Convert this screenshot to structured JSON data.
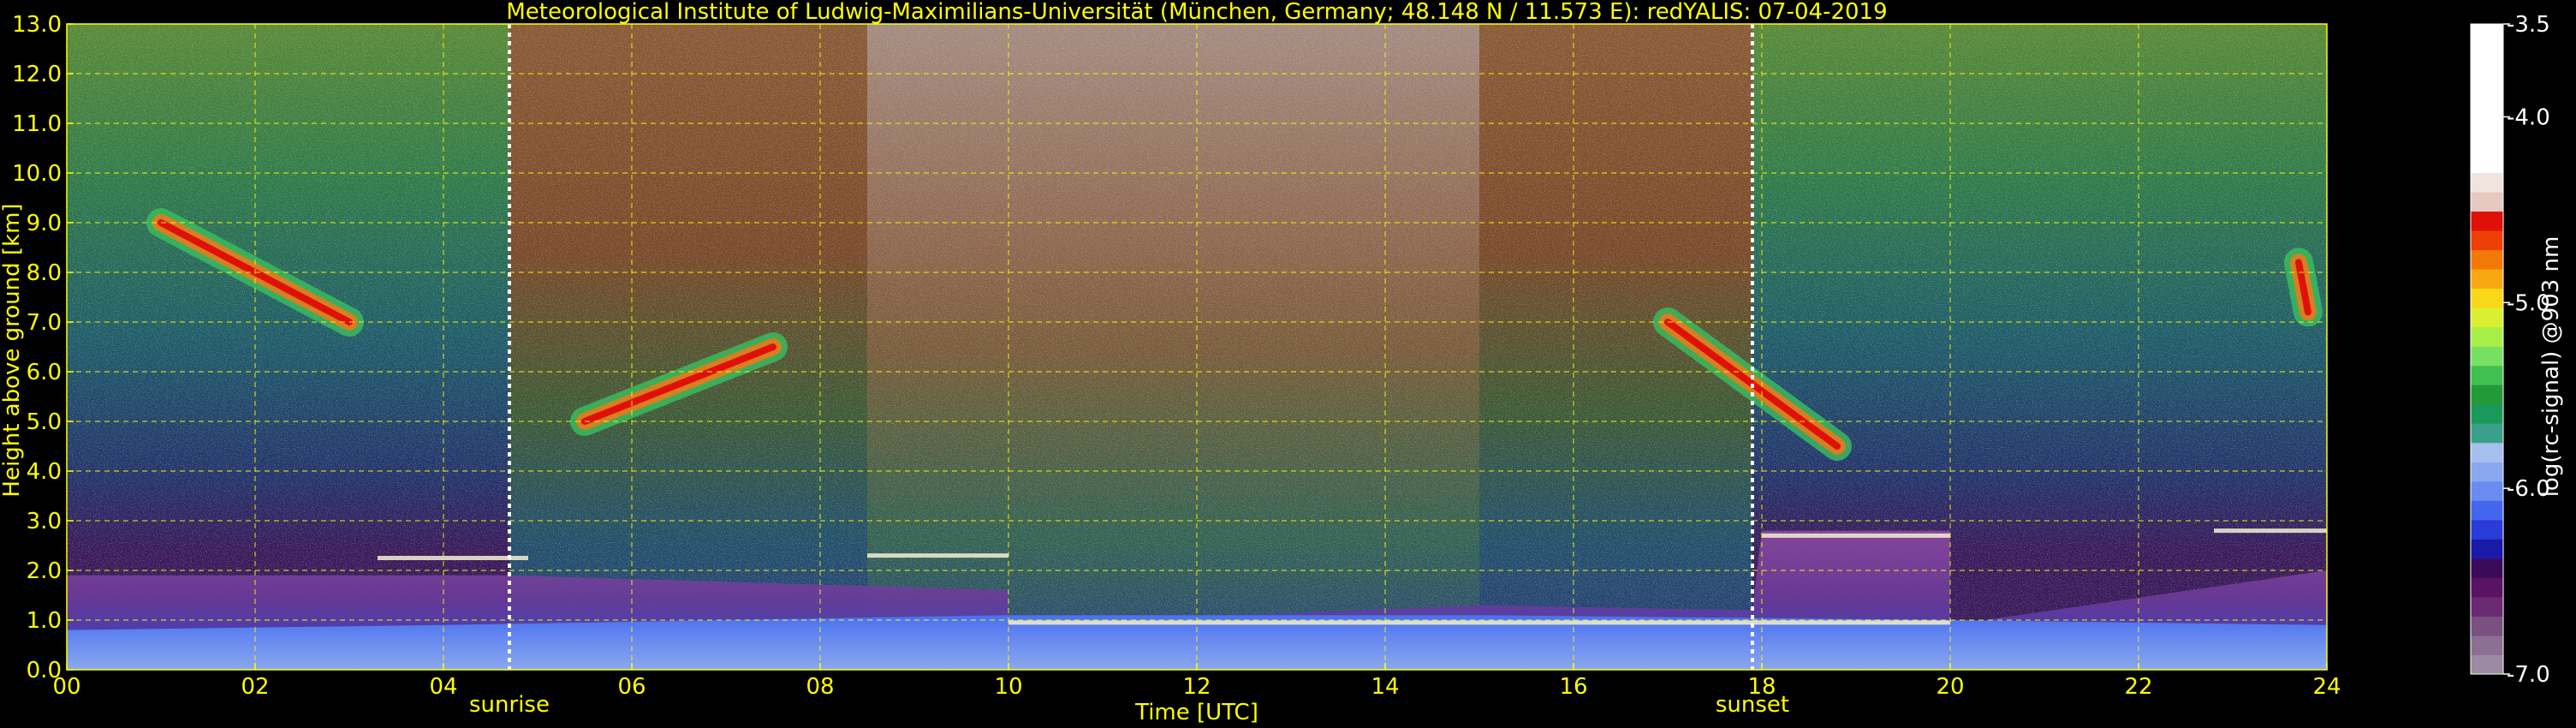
{
  "chart_data": {
    "type": "heatmap",
    "title": "Meteorological Institute of Ludwig-Maximilians-Universität (München, Germany; 48.148 N / 11.573 E):    redYALIS: 07-04-2019",
    "xlabel": "Time [UTC]",
    "ylabel": "Height above ground [km]",
    "xlim": [
      0,
      24
    ],
    "ylim": [
      0,
      13
    ],
    "x_ticks": [
      "00",
      "02",
      "04",
      "06",
      "08",
      "10",
      "12",
      "14",
      "16",
      "18",
      "20",
      "22",
      "24"
    ],
    "y_ticks": [
      "0.0",
      "1.0",
      "2.0",
      "3.0",
      "4.0",
      "5.0",
      "6.0",
      "7.0",
      "8.0",
      "9.0",
      "10.0",
      "11.0",
      "12.0",
      "13.0"
    ],
    "grid": true,
    "events": [
      {
        "label": "sunrise",
        "x": 4.7
      },
      {
        "label": "sunset",
        "x": 17.9
      }
    ],
    "colorbar": {
      "label": "log(rc-signal) @903 nm",
      "range": [
        -7.0,
        -3.5
      ],
      "ticks": [
        "-3.5",
        "-4.0",
        "-5.0",
        "-6.0",
        "-7.0"
      ],
      "tick_values": [
        -3.5,
        -4.0,
        -5.0,
        -6.0,
        -7.0
      ],
      "colors": [
        "#9b8aa3",
        "#8c6f93",
        "#7a4f82",
        "#6a2a72",
        "#5a1263",
        "#3b0b5a",
        "#1a1aa8",
        "#2a3cd8",
        "#4466ee",
        "#6a8cf2",
        "#8aa8f0",
        "#a6c0ee",
        "#3aa08a",
        "#1a9a5a",
        "#229a3a",
        "#40c050",
        "#78e060",
        "#a8ee48",
        "#d8f030",
        "#f8d818",
        "#f8a810",
        "#f47808",
        "#ec4006",
        "#e01008",
        "#e8c8c0",
        "#f0e4e0",
        "#ffffff"
      ]
    }
  }
}
